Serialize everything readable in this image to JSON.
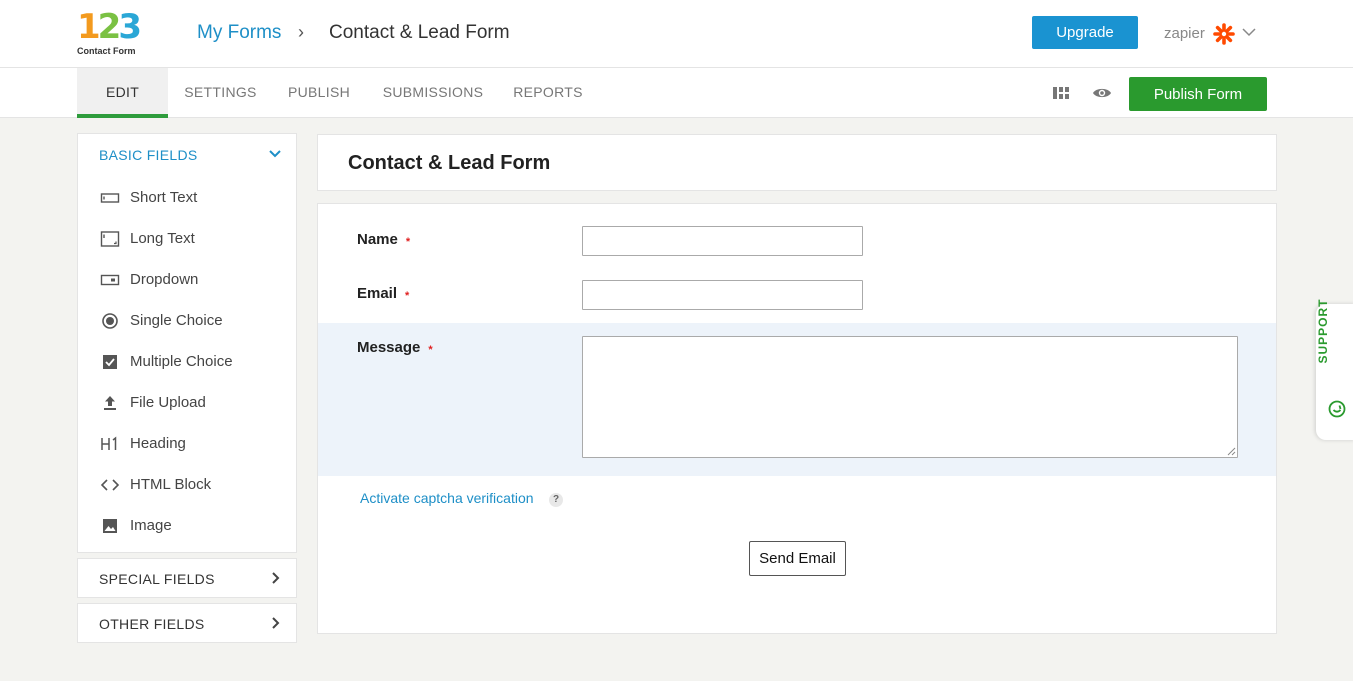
{
  "header": {
    "logo_digits": [
      "1",
      "2",
      "3"
    ],
    "logo_text": "Contact Form",
    "breadcrumb_link": "My Forms",
    "breadcrumb_sep": "›",
    "breadcrumb_current": "Contact & Lead Form",
    "upgrade_label": "Upgrade",
    "user_name": "zapier"
  },
  "tabs": [
    {
      "label": "EDIT",
      "active": true
    },
    {
      "label": "SETTINGS",
      "active": false
    },
    {
      "label": "PUBLISH",
      "active": false
    },
    {
      "label": "SUBMISSIONS",
      "active": false
    },
    {
      "label": "REPORTS",
      "active": false
    }
  ],
  "toolbar": {
    "publish_label": "Publish Form"
  },
  "sidebar": {
    "basic_label": "BASIC FIELDS",
    "basic_items": [
      {
        "label": "Short Text",
        "icon": "short-text-icon"
      },
      {
        "label": "Long Text",
        "icon": "long-text-icon"
      },
      {
        "label": "Dropdown",
        "icon": "dropdown-icon"
      },
      {
        "label": "Single Choice",
        "icon": "radio-icon"
      },
      {
        "label": "Multiple Choice",
        "icon": "checkbox-icon"
      },
      {
        "label": "File Upload",
        "icon": "upload-icon"
      },
      {
        "label": "Heading",
        "icon": "heading-icon"
      },
      {
        "label": "HTML Block",
        "icon": "code-icon"
      },
      {
        "label": "Image",
        "icon": "image-icon"
      }
    ],
    "special_label": "SPECIAL FIELDS",
    "other_label": "OTHER FIELDS"
  },
  "form": {
    "title": "Contact & Lead Form",
    "fields": [
      {
        "label": "Name",
        "required_mark": "*",
        "value": ""
      },
      {
        "label": "Email",
        "required_mark": "*",
        "value": ""
      },
      {
        "label": "Message",
        "required_mark": "*",
        "value": ""
      }
    ],
    "captcha_label": "Activate captcha verification",
    "help_mark": "?",
    "submit_label": "Send Email"
  },
  "support": {
    "label": "SUPPORT"
  },
  "colors": {
    "accent_blue": "#1e8fc7",
    "publish_green": "#2a9a2e",
    "tab_active_border": "#2e9c3c",
    "required_red": "#e02020"
  }
}
